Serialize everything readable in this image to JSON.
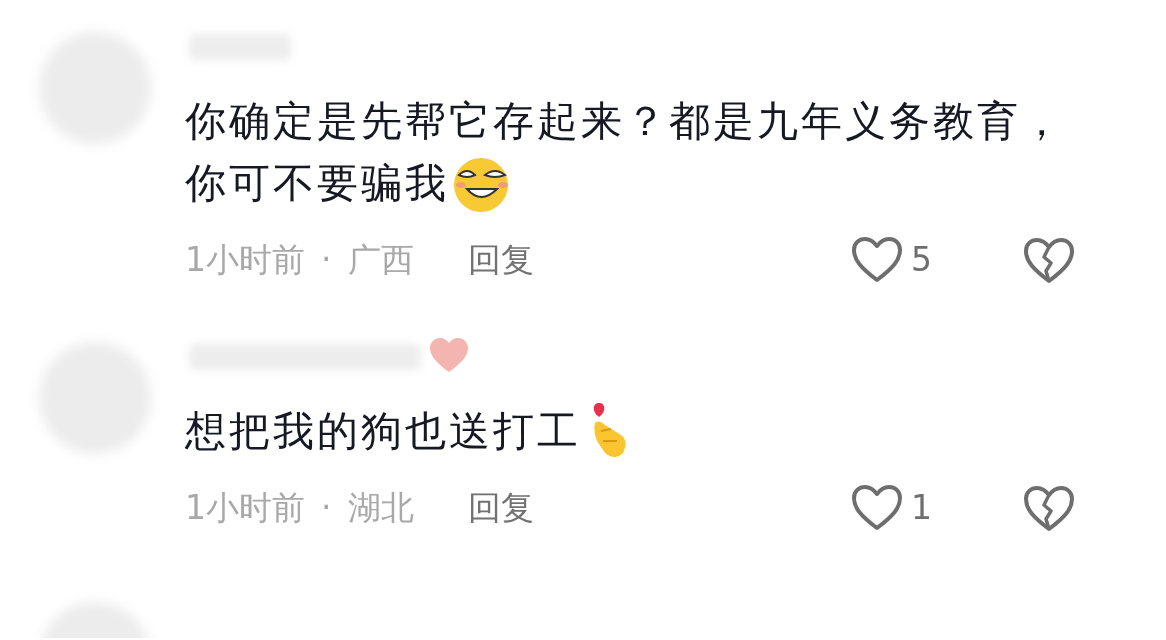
{
  "comments": [
    {
      "lines": [
        "你确定是先帮它存起来？都是九年义务教育，",
        "你可不要骗我"
      ],
      "time": "1小时前",
      "separator": "·",
      "location": "广西",
      "reply": "回复",
      "likes": "5"
    },
    {
      "lines": [
        "想把我的狗也送打工"
      ],
      "time": "1小时前",
      "separator": "·",
      "location": "湖北",
      "reply": "回复",
      "likes": "1"
    }
  ]
}
